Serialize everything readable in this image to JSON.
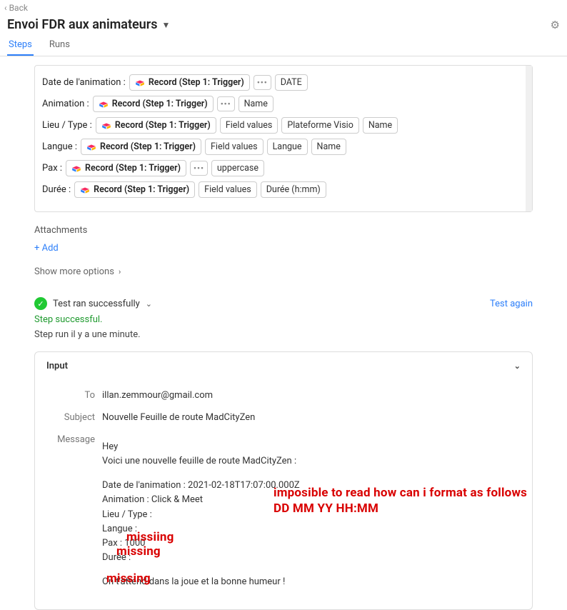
{
  "nav": {
    "back": "‹ Back"
  },
  "header": {
    "title": "Envoi FDR aux animateurs"
  },
  "tabs": {
    "steps": "Steps",
    "runs": "Runs"
  },
  "pill_main": "Record (Step 1: Trigger)",
  "rows": [
    {
      "label": "Date de l'animation :",
      "after": [
        "…",
        "DATE"
      ]
    },
    {
      "label": "Animation :",
      "after": [
        "…",
        "Name"
      ]
    },
    {
      "label": "Lieu / Type :",
      "after": [
        "Field values",
        "Plateforme Visio",
        "Name"
      ]
    },
    {
      "label": "Langue :",
      "after": [
        "Field values",
        "Langue",
        "Name"
      ]
    },
    {
      "label": "Pax :",
      "after": [
        "…",
        "uppercase"
      ]
    },
    {
      "label": "Durée :",
      "after": [
        "Field values",
        "Durée (h:mm)"
      ]
    }
  ],
  "sections": {
    "attachments": "Attachments",
    "add": "+ Add",
    "showMore": "Show more options"
  },
  "test": {
    "ran": "Test ran successfully",
    "again": "Test again",
    "stepSuccess": "Step successful.",
    "stepTime": "Step run il y a une minute."
  },
  "input": {
    "header": "Input",
    "to": {
      "label": "To",
      "value": "illan.zemmour@gmail.com"
    },
    "subject": {
      "label": "Subject",
      "value": "Nouvelle Feuille de route MadCityZen"
    },
    "message": {
      "label": "Message",
      "hey": "Hey",
      "intro": "Voici une nouvelle feuille de route MadCityZen :",
      "lines": [
        "Date de l'animation : 2021-02-18T17:07:00.000Z",
        "Animation : Click & Meet",
        "Lieu / Type :",
        "Langue :",
        "Pax : 1000",
        "Durée :"
      ],
      "outro": "On t'attend dans la joue et la bonne humeur !"
    }
  },
  "annotations": {
    "line1": "imposible to read how can i format as follows",
    "line2": "DD MM YY   HH:MM",
    "missing1": "missiing",
    "missing2": "missing",
    "missing3": "missing"
  }
}
